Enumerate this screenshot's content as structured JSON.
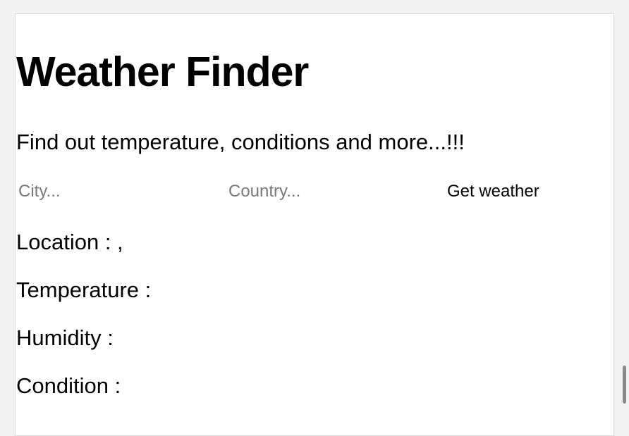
{
  "page": {
    "title": "Weather Finder",
    "subtitle": "Find out temperature, conditions and more...!!!"
  },
  "form": {
    "city_placeholder": "City...",
    "country_placeholder": "Country...",
    "city_value": "",
    "country_value": "",
    "button_label": "Get weather"
  },
  "results": {
    "location_label": "Location : ,",
    "temperature_label": "Temperature :",
    "humidity_label": "Humidity :",
    "condition_label": "Condition :"
  }
}
